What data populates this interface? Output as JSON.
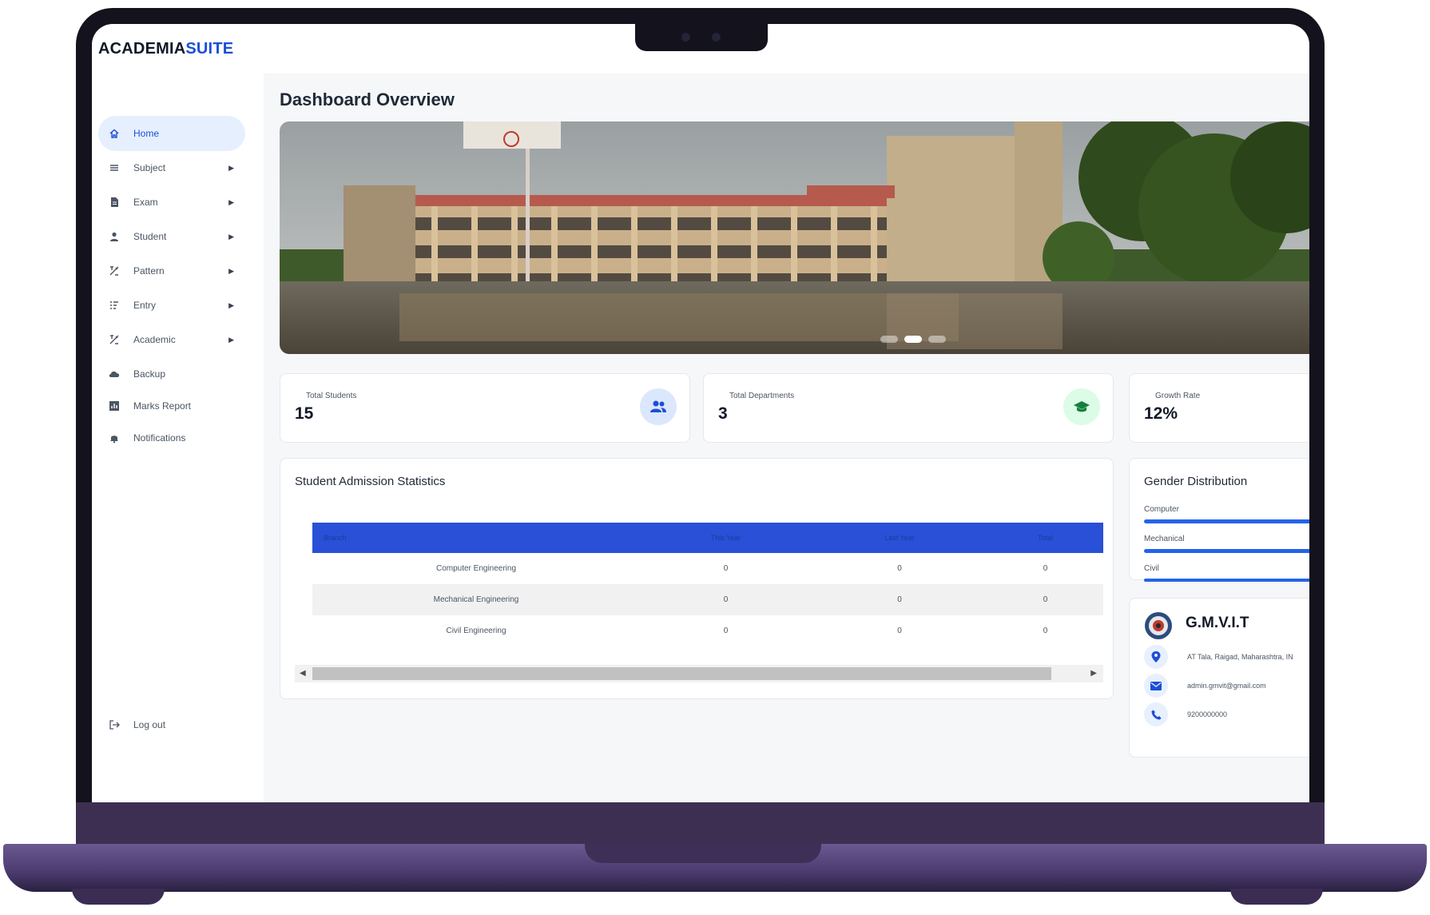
{
  "brand": {
    "part1": "ACADEMIA",
    "part2": "SUITE"
  },
  "sidebar": {
    "items": [
      {
        "label": "Home",
        "icon": "home-icon",
        "active": true
      },
      {
        "label": "Subject",
        "icon": "list-icon",
        "has_submenu": true
      },
      {
        "label": "Exam",
        "icon": "document-icon",
        "has_submenu": true
      },
      {
        "label": "Student",
        "icon": "person-icon",
        "has_submenu": true
      },
      {
        "label": "Pattern",
        "icon": "pattern-icon",
        "has_submenu": true
      },
      {
        "label": "Entry",
        "icon": "entry-icon",
        "has_submenu": true
      },
      {
        "label": "Academic",
        "icon": "academic-icon",
        "has_submenu": true
      },
      {
        "label": "Backup",
        "icon": "cloud-icon"
      },
      {
        "label": "Marks Report",
        "icon": "bar-chart-icon"
      },
      {
        "label": "Notifications",
        "icon": "bell-icon"
      }
    ],
    "logout": "Log out",
    "submenu_arrow": "▶"
  },
  "main": {
    "title": "Dashboard Overview",
    "stats": [
      {
        "label": "Total Students",
        "value": "15",
        "icon": "people-icon",
        "icon_color": "#1d4ed8",
        "icon_bg": "#dbe7fd"
      },
      {
        "label": "Total Departments",
        "value": "3",
        "icon": "graduation-cap-icon",
        "icon_color": "#16a34a",
        "icon_bg": "#dcfce7"
      },
      {
        "label": "Growth Rate",
        "value": "12%"
      }
    ],
    "admission": {
      "title": "Student Admission Statistics",
      "columns": [
        "Branch",
        "This Year",
        "Last Year",
        "Total"
      ],
      "rows": [
        [
          "Computer Engineering",
          "0",
          "0",
          "0"
        ],
        [
          "Mechanical Engineering",
          "0",
          "0",
          "0"
        ],
        [
          "Civil Engineering",
          "0",
          "0",
          "0"
        ]
      ]
    },
    "gender": {
      "title": "Gender Distribution",
      "items": [
        {
          "label": "Computer",
          "fill": 1.0
        },
        {
          "label": "Mechanical",
          "fill": 1.0
        },
        {
          "label": "Civil",
          "fill": 1.0
        }
      ]
    },
    "institute": {
      "name": "G.M.V.I.T",
      "address": "AT  Tala, Raigad, Maharashtra, IN",
      "email": "admin.gmvit@gmail.com",
      "phone": "9200000000"
    },
    "carousel": {
      "slides": 3,
      "active": 2
    }
  },
  "colors": {
    "accent": "#1d4ed8",
    "table_header": "#2950d6",
    "active_nav_bg": "#e6effe"
  }
}
